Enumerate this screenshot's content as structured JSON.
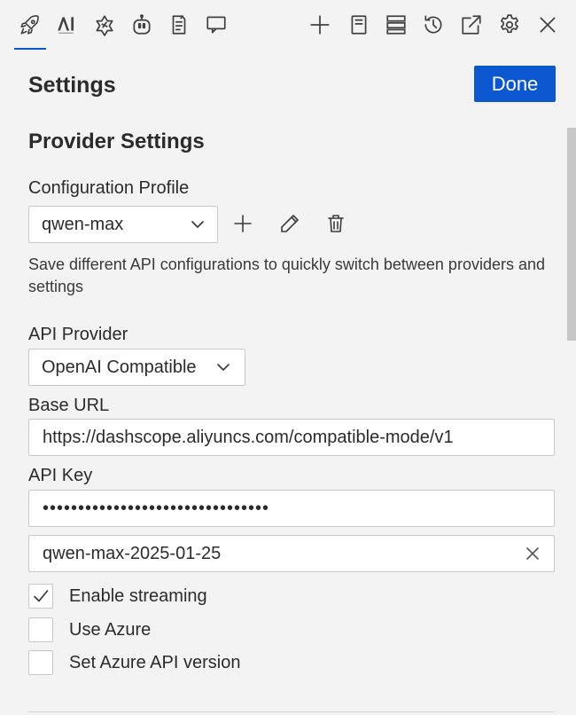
{
  "toolbar": {
    "left_icons": [
      "rocket-icon",
      "ai-code-icon",
      "starburst-icon",
      "robot-icon",
      "notes-icon",
      "chat-icon"
    ],
    "right_icons": [
      "plus-icon",
      "history-panel-icon",
      "server-icon",
      "history-icon",
      "open-external-icon",
      "gear-icon",
      "close-icon"
    ]
  },
  "header": {
    "title": "Settings",
    "done_label": "Done"
  },
  "provider": {
    "section_title": "Provider Settings",
    "config_profile_label": "Configuration Profile",
    "config_profile_value": "qwen-max",
    "description": "Save different API configurations to quickly switch between providers and settings",
    "api_provider_label": "API Provider",
    "api_provider_value": "OpenAI Compatible",
    "base_url_label": "Base URL",
    "base_url_value": "https://dashscope.aliyuncs.com/compatible-mode/v1",
    "api_key_label": "API Key",
    "api_key_value": "••••••••••••••••••••••••••••••••",
    "model_value": "qwen-max-2025-01-25"
  },
  "options": [
    {
      "label": "Enable streaming",
      "checked": true
    },
    {
      "label": "Use Azure",
      "checked": false
    },
    {
      "label": "Set Azure API version",
      "checked": false
    }
  ],
  "colors": {
    "accent": "#0b57d0",
    "background": "#f3f3f3",
    "input_bg": "#ffffff",
    "border": "#c8c8c8"
  }
}
